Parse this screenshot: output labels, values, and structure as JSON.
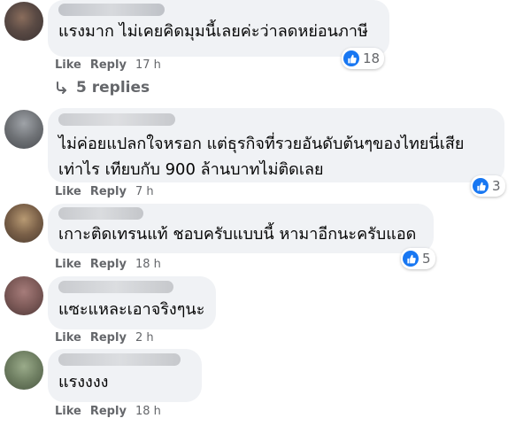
{
  "colors": {
    "bubble_bg": "#f0f2f5",
    "meta_text": "#65676b",
    "like_blue": "#1877f2"
  },
  "action_labels": {
    "like": "Like",
    "reply": "Reply"
  },
  "comments": [
    {
      "lines": [
        "แรงมาก ไม่เคยคิดมุมนี้เลยค่ะว่าลดหย่อนภาษี"
      ],
      "time": "17 h",
      "reaction_count": "18",
      "replies_label": "5 replies"
    },
    {
      "lines": [
        "ไม่ค่อยแปลกใจหรอก แต่ธุรกิจที่รวยอันดับต้นๆของไทยนี่เสีย",
        "เท่าไร เทียบกับ 900 ล้านบาทไม่ติดเลย"
      ],
      "time": "7 h",
      "reaction_count": "3"
    },
    {
      "lines": [
        "เกาะติดเทรนแท้ ชอบครับแบบนี้ หามาอีกนะครับแอด"
      ],
      "time": "18 h",
      "reaction_count": "5"
    },
    {
      "lines": [
        "แซะแหละเอาจริงๆนะ"
      ],
      "time": "2 h"
    },
    {
      "lines": [
        "แรงงงง"
      ],
      "time": "18 h"
    }
  ]
}
